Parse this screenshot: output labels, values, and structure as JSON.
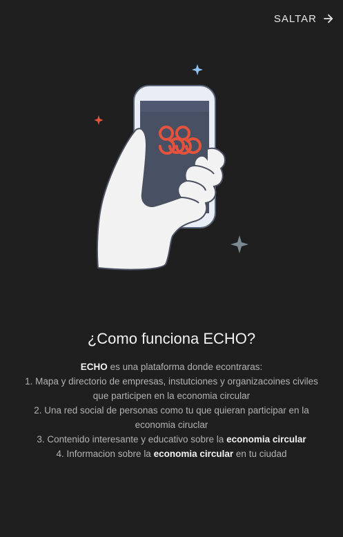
{
  "header": {
    "skip_label": "SALTAR",
    "skip_icon": "arrow-right-icon"
  },
  "colors": {
    "background": "#1f1f1f",
    "accent": "#e5533d",
    "phone": "#4a5060"
  },
  "title": "¿Como funciona ECHO?",
  "intro": {
    "brand": "ECHO",
    "text": "es una plataforma donde econtraras:"
  },
  "items": [
    {
      "text": "1. Mapa y directorio de empresas, instutciones y organizacoines civiles que participen en la economia circular"
    },
    {
      "text": "2. Una red social de personas como tu que quieran participar en la economia ciruclar"
    },
    {
      "prefix": "3. Contenido interesante y educativo sobre la",
      "highlight": "economia circular",
      "suffix": ""
    },
    {
      "prefix": "4. Informacion sobre la",
      "highlight": "economia circular",
      "suffix": "en tu ciudad"
    }
  ]
}
